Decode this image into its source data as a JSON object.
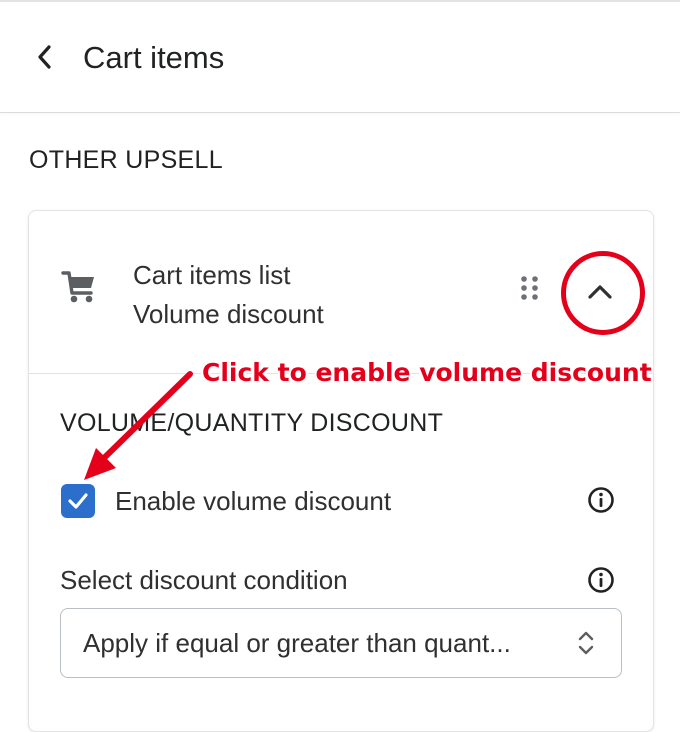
{
  "header": {
    "title": "Cart items",
    "back_icon": "chevron-left-icon"
  },
  "section": {
    "heading": "OTHER UPSELL"
  },
  "block": {
    "icon": "cart-icon",
    "title": "Cart items list",
    "subtitle": "Volume discount",
    "drag_icon": "drag-handle-icon",
    "toggle_icon": "chevron-up-icon",
    "expanded": true
  },
  "volume_discount": {
    "heading": "VOLUME/QUANTITY DISCOUNT",
    "enable_label": "Enable volume discount",
    "enabled": true,
    "condition_label": "Select discount condition",
    "condition_value": "Apply if equal or greater than quant...",
    "info_icon": "info-circle-icon"
  },
  "annotation": {
    "text": "Click to enable volume discount",
    "color": "#e4001b"
  },
  "colors": {
    "checkbox": "#2c6ecb",
    "text": "#202223",
    "annotation": "#e4001b"
  }
}
